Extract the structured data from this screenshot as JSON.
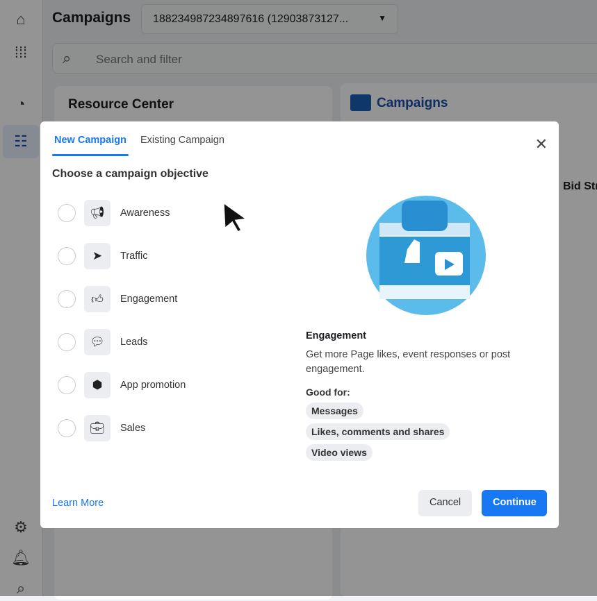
{
  "header": {
    "title": "Campaigns",
    "account": "188234987234897616 (12903873127...",
    "search_placeholder": "Search and filter"
  },
  "background": {
    "resource_center": "Resource Center",
    "campaigns_panel": "Campaigns",
    "column": "Bid Str"
  },
  "modal": {
    "tabs": [
      {
        "label": "New Campaign",
        "active": true
      },
      {
        "label": "Existing Campaign",
        "active": false
      }
    ],
    "subtitle": "Choose a campaign objective",
    "objectives": [
      {
        "label": "Awareness",
        "icon": "megaphone-icon"
      },
      {
        "label": "Traffic",
        "icon": "cursor-icon"
      },
      {
        "label": "Engagement",
        "icon": "thumbs-up-icon"
      },
      {
        "label": "Leads",
        "icon": "chat-bubbles-icon"
      },
      {
        "label": "App promotion",
        "icon": "box-icon"
      },
      {
        "label": "Sales",
        "icon": "shopping-bag-icon"
      }
    ],
    "detail": {
      "title": "Engagement",
      "description": "Get more Page likes, event responses or post engagement.",
      "good_for_label": "Good for:",
      "good_for": [
        "Messages",
        "Likes, comments and shares",
        "Video views"
      ]
    },
    "learn_more": "Learn More",
    "cancel": "Cancel",
    "continue": "Continue"
  },
  "colors": {
    "accent": "#1877f2"
  }
}
